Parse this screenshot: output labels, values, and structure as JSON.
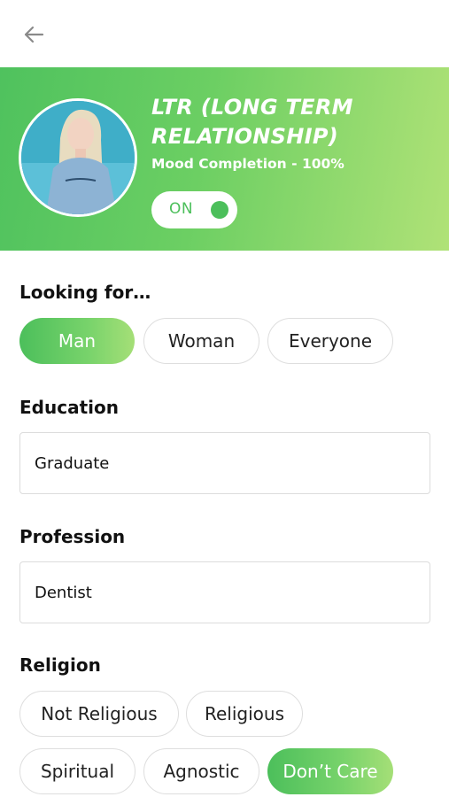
{
  "header": {
    "back_icon": "arrow-left-icon"
  },
  "mood": {
    "title": "LTR (LONG TERM RELATIONSHIP)",
    "completion": "Mood Completion - 100%",
    "toggle_label": "ON",
    "toggle_on": true
  },
  "looking_for": {
    "label": "Looking for…",
    "options": [
      "Man",
      "Woman",
      "Everyone"
    ],
    "selected": "Man"
  },
  "education": {
    "label": "Education",
    "value": "Graduate"
  },
  "profession": {
    "label": "Profession",
    "value": "Dentist"
  },
  "religion": {
    "label": "Religion",
    "options": [
      "Not Religious",
      "Religious",
      "Spiritual",
      "Agnostic",
      "Don’t Care"
    ],
    "selected": "Don’t Care"
  },
  "colors": {
    "accent": "#4cbf5b",
    "accent_light": "#b0e277"
  }
}
